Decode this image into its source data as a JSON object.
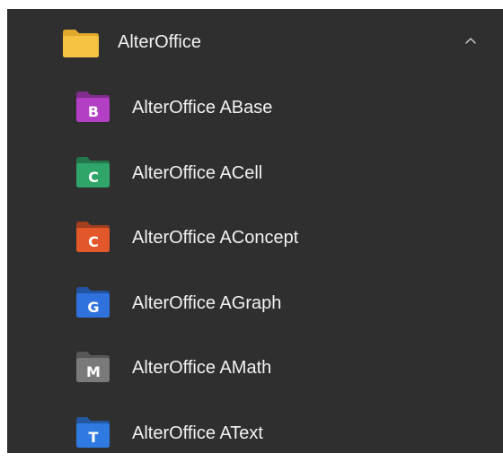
{
  "group": {
    "label": "AlterOffice",
    "folder_color": "#f5c242",
    "expanded": true
  },
  "apps": [
    {
      "label": "AlterOffice ABase",
      "letter": "B",
      "color": "#b23fc4",
      "icon": "abase-app-icon"
    },
    {
      "label": "AlterOffice ACell",
      "letter": "C",
      "color": "#2fa56a",
      "icon": "acell-app-icon"
    },
    {
      "label": "AlterOffice AConcept",
      "letter": "C",
      "color": "#e2582a",
      "icon": "aconcept-app-icon"
    },
    {
      "label": "AlterOffice AGraph",
      "letter": "G",
      "color": "#2f72de",
      "icon": "agraph-app-icon"
    },
    {
      "label": "AlterOffice AMath",
      "letter": "M",
      "color": "#7a7a7a",
      "icon": "amath-app-icon"
    },
    {
      "label": "AlterOffice AText",
      "letter": "T",
      "color": "#2f7ae0",
      "icon": "atext-app-icon"
    }
  ]
}
